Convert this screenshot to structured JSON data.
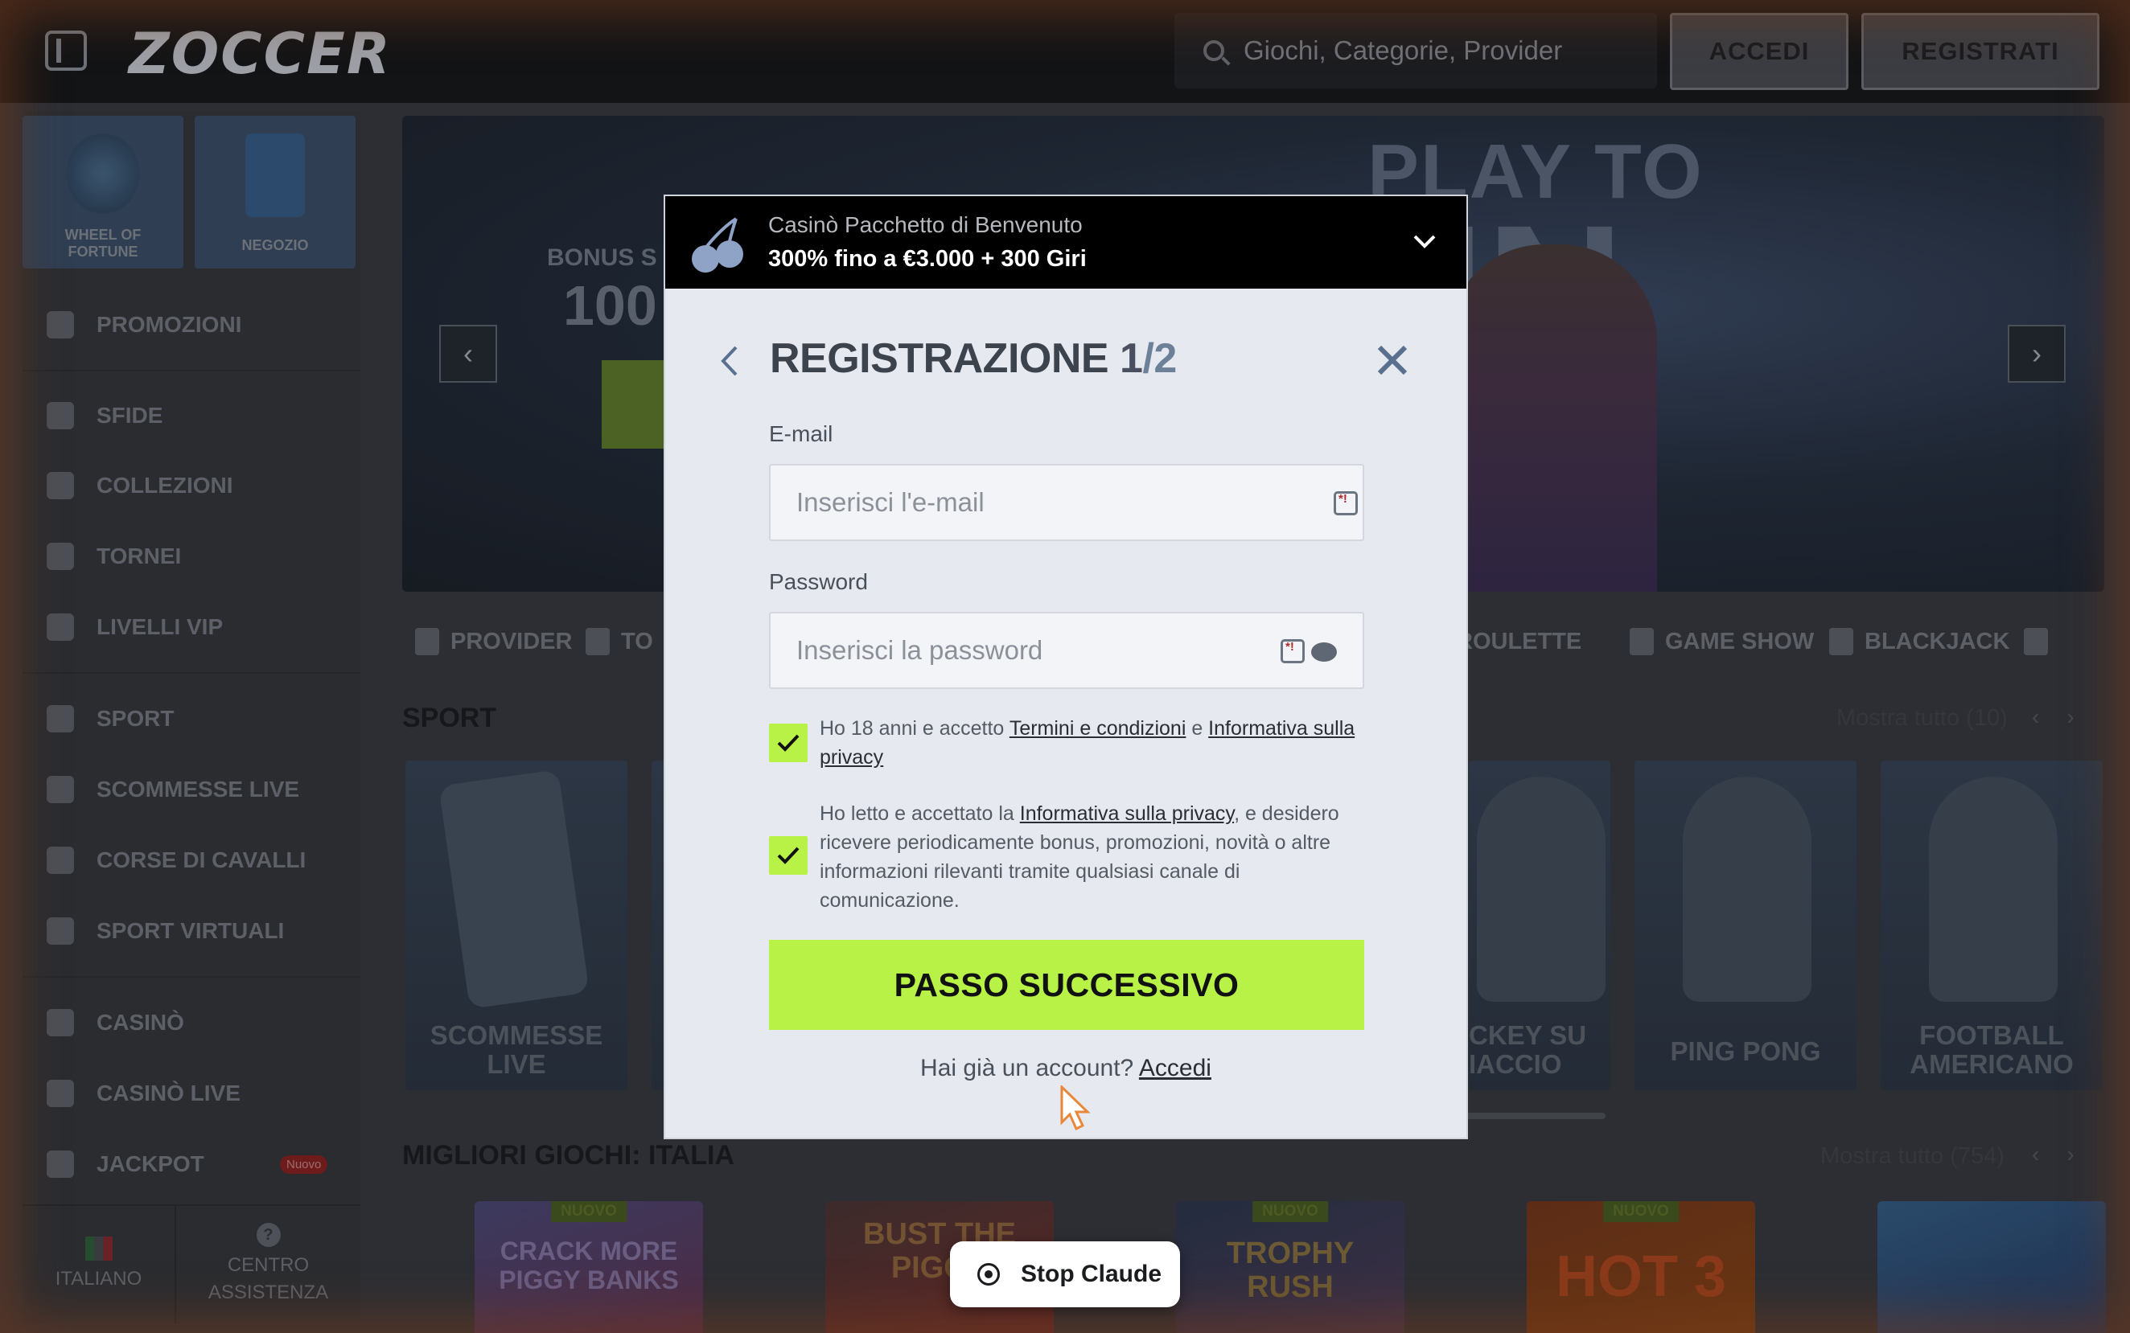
{
  "header": {
    "logo": "ZOCCER",
    "search_placeholder": "Giochi, Categorie, Provider",
    "login_label": "ACCEDI",
    "register_label": "REGISTRATI"
  },
  "sidebar": {
    "tiles": [
      {
        "label": "WHEEL OF FORTUNE",
        "icon": "wheel-icon"
      },
      {
        "label": "NEGOZIO",
        "icon": "shopping-bag-icon"
      }
    ],
    "items": [
      {
        "label": "PROMOZIONI",
        "icon": "gift-icon"
      },
      {
        "label": "SFIDE",
        "icon": "medal-icon"
      },
      {
        "label": "COLLEZIONI",
        "icon": "collection-icon"
      },
      {
        "label": "TORNEI",
        "icon": "podium-icon"
      },
      {
        "label": "LIVELLI VIP",
        "icon": "shield-icon"
      },
      {
        "label": "SPORT",
        "icon": "ball-icon"
      },
      {
        "label": "SCOMMESSE LIVE",
        "icon": "camera-icon"
      },
      {
        "label": "CORSE DI CAVALLI",
        "icon": "horse-icon"
      },
      {
        "label": "SPORT VIRTUALI",
        "icon": "car-icon"
      },
      {
        "label": "CASINÒ",
        "icon": "cherry-icon"
      },
      {
        "label": "CASINÒ LIVE",
        "icon": "live-cards-icon"
      },
      {
        "label": "JACKPOT",
        "icon": "horseshoe-icon",
        "badge": "Nuovo"
      }
    ],
    "footer": {
      "language": "ITALIANO",
      "help": "CENTRO ASSISTENZA"
    }
  },
  "hero": {
    "headline_1": "PLAY TO",
    "headline_2": "IN",
    "bonus_text": "BONUS S",
    "bonus_pct": "100"
  },
  "categories": [
    "PROVIDER",
    "TO",
    "ROULETTE",
    "GAME SHOW",
    "BLACKJACK"
  ],
  "sport_section": {
    "title": "SPORT",
    "show_all": "Mostra tutto (10)",
    "cards": [
      "SCOMMESSE LIVE",
      "CKEY SU IACCIO",
      "PING PONG",
      "FOOTBALL AMERICANO"
    ]
  },
  "best_section": {
    "title": "MIGLIORI GIOCHI: ITALIA",
    "show_all": "Mostra tutto (754)",
    "games": [
      {
        "title": "CRACK MORE PIGGY BANKS",
        "badge": "NUOVO"
      },
      {
        "title": "BUST THE PIGGY",
        "badge": ""
      },
      {
        "title": "TROPHY RUSH",
        "badge": "NUOVO"
      },
      {
        "title": "HOT 3",
        "badge": "NUOVO"
      },
      {
        "title": "",
        "badge": ""
      }
    ]
  },
  "modal": {
    "banner_title": "Casinò Pacchetto di Benvenuto",
    "banner_offer": "300% fino a €3.000 + 300 Giri",
    "title": "REGISTRAZIONE",
    "step_current": "1",
    "step_total": "/2",
    "email_label": "E-mail",
    "email_placeholder": "Inserisci l'e-mail",
    "password_label": "Password",
    "password_placeholder": "Inserisci la password",
    "consent1_pre": "Ho 18 anni e accetto ",
    "consent1_link1": "Termini e condizioni",
    "consent1_mid": " e ",
    "consent1_link2": "Informativa sulla privacy",
    "consent2_pre": "Ho letto e accettato la ",
    "consent2_link": "Informativa sulla privacy",
    "consent2_post": ", e desidero ricevere periodicamente bonus, promozioni, novità o altre informazioni rilevanti tramite qualsiasi canale di comunicazione.",
    "next_button": "PASSO SUCCESSIVO",
    "already_text": "Hai già un account? ",
    "already_link": "Accedi"
  },
  "stop_button": "Stop Claude",
  "colors": {
    "accent_green": "#b9f247",
    "modal_bg": "#e6e9ef",
    "banner_bg": "#000000"
  }
}
